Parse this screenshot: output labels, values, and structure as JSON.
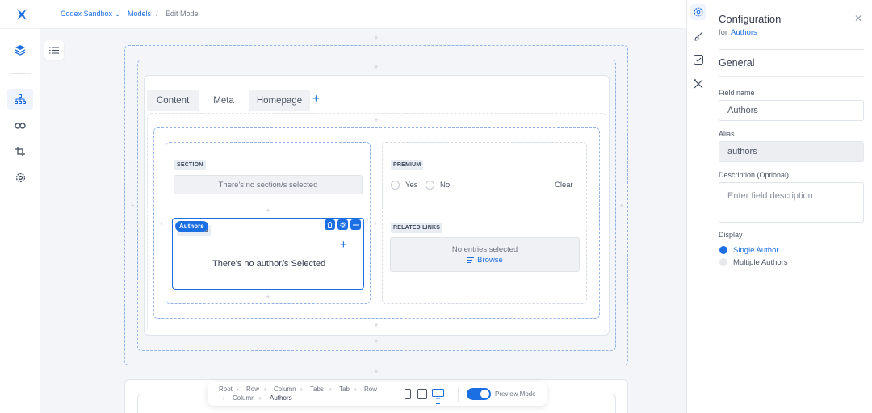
{
  "breadcrumb": {
    "workspace": "Codex Sandbox",
    "models": "Models",
    "current": "Edit Model",
    "separator": "/"
  },
  "tabs": [
    {
      "label": "Content"
    },
    {
      "label": "Meta"
    },
    {
      "label": "Homepage"
    }
  ],
  "fields": {
    "section": {
      "label": "SECTION",
      "empty": "There's no section/s selected"
    },
    "authors": {
      "chip": "Authors",
      "label_hidden": "AUTHORS",
      "empty": "There's no author/s Selected"
    },
    "premium": {
      "label": "PREMIUM",
      "yes": "Yes",
      "no": "No",
      "clear": "Clear"
    },
    "related": {
      "label": "RELATED LINKS",
      "empty": "No entries selected",
      "browse": "Browse"
    }
  },
  "bottom_bar": {
    "path": [
      "Root",
      "Row",
      "Column",
      "Tabs",
      "Tab",
      "Row",
      "Column",
      "Authors"
    ],
    "preview_label": "Preview Mode",
    "preview_on": true
  },
  "config": {
    "title": "Configuration",
    "for_prefix": "for",
    "for_target": "Authors",
    "section_title": "General",
    "field_name_label": "Field name",
    "field_name_value": "Authors",
    "alias_label": "Alias",
    "alias_value": "authors",
    "description_label": "Description (Optional)",
    "description_placeholder": "Enter field description",
    "display_label": "Display",
    "display_options": [
      {
        "label": "Single Author",
        "selected": true
      },
      {
        "label": "Multiple Authors",
        "selected": false
      }
    ]
  },
  "colors": {
    "accent": "#1c6fe3",
    "dash": "#8fb2e8"
  }
}
